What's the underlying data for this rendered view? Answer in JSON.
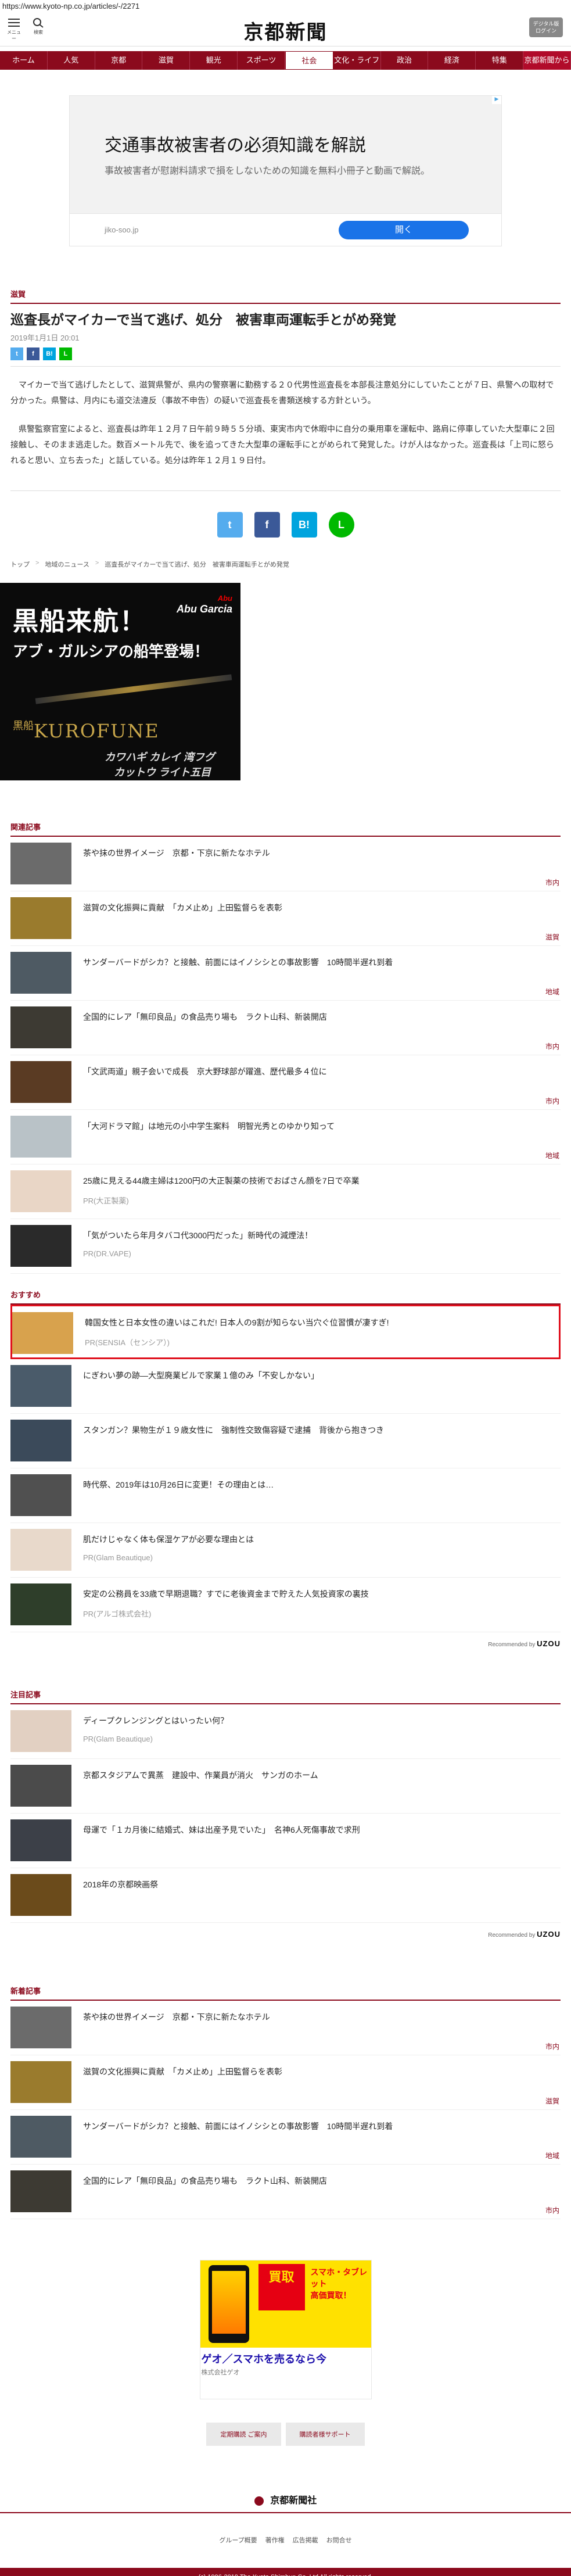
{
  "url": "https://www.kyoto-np.co.jp/articles/-/2271",
  "header": {
    "menu_label": "メニュー",
    "search_label": "検索",
    "logo": "京都新聞",
    "right_label_1": "デジタル版",
    "right_label_2": "ログイン"
  },
  "nav": [
    "ホーム",
    "人気",
    "京都",
    "滋賀",
    "観光",
    "スポーツ",
    "社会",
    "文化・ライフ",
    "政治",
    "経済",
    "特集",
    "京都新聞から"
  ],
  "colors": {
    "brand": "#8b0a1d",
    "ad_button": "#1a73e8",
    "highlight": "#e0101d"
  },
  "ad_top": {
    "title": "交通事故被害者の必須知識を解説",
    "desc": "事故被害者が慰謝料請求で損をしないための知識を無料小冊子と動画で解説。",
    "domain": "jiko-soo.jp",
    "button": "開く"
  },
  "article": {
    "category": "滋賀",
    "title": "巡査長がマイカーで当て逃げ、処分　被害車両運転手とがめ発覚",
    "date": "2019年1月1日 20:01",
    "paragraphs": [
      "マイカーで当て逃げしたとして、滋賀県警が、県内の警察署に勤務する２０代男性巡査長を本部長注意処分にしていたことが７日、県警への取材で分かった。県警は、月内にも道交法違反（事故不申告）の疑いで巡査長を書類送検する方針という。",
      "県警監察官室によると、巡査長は昨年１２月７日午前９時５５分頃、東実市内で休暇中に自分の乗用車を運転中、路肩に停車していた大型車に２回接触し、そのまま逃走した。数百メートル先で、後を追ってきた大型車の運転手にとがめられて発覚した。けが人はなかった。巡査長は「上司に怒られると思い、立ち去った」と話している。処分は昨年１２月１９日付。"
    ],
    "share_small": [
      "t",
      "f",
      "B!",
      "L"
    ],
    "share_big": [
      "t",
      "f",
      "B!",
      "L"
    ],
    "crumbs": [
      "トップ",
      "地域のニュース",
      "巡査長がマイカーで当て逃げ、処分　被害車両運転手とがめ発覚"
    ]
  },
  "ad_blackship": {
    "line1": "黒船来航！",
    "line2": "アブ・ガルシアの船竿登場！",
    "brand": "Abu Garcia",
    "brand_sub": "Abu",
    "product": "KUROFUNE",
    "kanji": "黒船",
    "sub1": "カワハギ カレイ 湾フグ",
    "sub2": "カットウ ライト五目"
  },
  "related": {
    "heading": "関連記事",
    "items": [
      {
        "title": "茶や抹の世界イメージ　京都・下京に新たなホテル",
        "tag": "市内",
        "pr": "",
        "img": "#6b6b6b"
      },
      {
        "title": "滋賀の文化振興に貢献　「カメ止め」上田監督らを表彰",
        "tag": "滋賀",
        "pr": "",
        "img": "#9a7b2d"
      },
      {
        "title": "サンダーバードがシカ？と接触、前面にはイノシシとの事故影響　10時間半遅れ到着",
        "tag": "地域",
        "pr": "",
        "img": "#4e5a63"
      },
      {
        "title": "全国的にレア「無印良品」の食品売り場も　ラクト山科、新装開店",
        "tag": "市内",
        "pr": "",
        "img": "#3d3a33"
      },
      {
        "title": "「文武両道」親子会いで成長　京大野球部が躍進、歴代最多４位に",
        "tag": "市内",
        "pr": "",
        "img": "#5a3b23"
      },
      {
        "title": "「大河ドラマ館」は地元の小中学生案料　明智光秀とのゆかり知って",
        "tag": "地域",
        "pr": "",
        "img": "#b9c2c7"
      },
      {
        "title": "25歳に見える44歳主婦は1200円の大正製薬の技術でおばさん顔を7日で卒業",
        "tag": "",
        "pr": "PR(大正製薬)",
        "img": "#e9d6c6"
      },
      {
        "title": "「気がついたら年月タバコ代3000円だった」新時代の減煙法！",
        "tag": "",
        "pr": "PR(DR.VAPE)",
        "img": "#2a2a2a"
      }
    ]
  },
  "recommended": {
    "heading": "おすすめ",
    "items": [
      {
        "title": "韓国女性と日本女性の違いはこれだ! 日本人の9割が知らない当穴ぐ位習慣が凄すぎ!",
        "pr": "PR(SENSIA（センシア）)",
        "img": "#d8a24d",
        "highlight": true
      },
      {
        "title": "にぎわい夢の跡―大型廃業ビルで家業１億のみ「不安しかない」",
        "pr": "",
        "img": "#4a5b6a",
        "highlight": false
      },
      {
        "title": "スタンガン？果物生が１９歳女性に　強制性交致傷容疑で逮捕　背後から抱きつき",
        "pr": "",
        "img": "#3b4a5a",
        "highlight": false
      },
      {
        "title": "時代祭、2019年は10月26日に変更！その理由とは…",
        "pr": "",
        "img": "#505050",
        "highlight": false
      },
      {
        "title": "肌だけじゃなく体も保湿ケアが必要な理由とは",
        "pr": "PR(Glam Beautique)",
        "img": "#e8d9cb",
        "highlight": false
      },
      {
        "title": "安定の公務員を33歳で早期退職？すでに老後資金まで貯えた人気投資家の裏技",
        "pr": "PR(アルゴ株式会社)",
        "img": "#2e3e2a",
        "highlight": false
      }
    ],
    "powered": "Recommended by",
    "powered_brand": "UZOU"
  },
  "attention": {
    "heading": "注目記事",
    "items": [
      {
        "title": "ディープクレンジングとはいったい何？",
        "pr": "PR(Glam Beautique)",
        "img": "#e2d0c2"
      },
      {
        "title": "京都スタジアムで異蒸　建設中、作業員が消火　サンガのホーム",
        "pr": "",
        "img": "#4b4b4b"
      },
      {
        "title": "母運で「１カ月後に結婚式、妹は出産予見でいた」　名神6人死傷事故で求刑",
        "pr": "",
        "img": "#3c4048"
      },
      {
        "title": "2018年の京都映画祭",
        "pr": "",
        "img": "#6b4b1b"
      }
    ],
    "powered": "Recommended by",
    "powered_brand": "UZOU"
  },
  "newest": {
    "heading": "新着記事",
    "items": [
      {
        "title": "茶や抹の世界イメージ　京都・下京に新たなホテル",
        "tag": "市内",
        "img": "#6b6b6b"
      },
      {
        "title": "滋賀の文化振興に貢献　「カメ止め」上田監督らを表彰",
        "tag": "滋賀",
        "img": "#9a7b2d"
      },
      {
        "title": "サンダーバードがシカ？と接触、前面にはイノシシとの事故影響　10時間半遅れ到着",
        "tag": "地域",
        "img": "#4e5a63"
      },
      {
        "title": "全国的にレア「無印良品」の食品売り場も　ラクト山科、新装開店",
        "tag": "市内",
        "img": "#3d3a33"
      }
    ]
  },
  "ad_bottom": {
    "kaitori": "買取",
    "right_1": "スマホ・タブレット",
    "right_2": "高価買取！",
    "title": "ゲオ／スマホを売るなら今",
    "advertiser": "株式会社ゲオ"
  },
  "footer": {
    "btn_1": "定期購読 ご案内",
    "btn_2": "購読者様サポート",
    "logo": "京都新聞社",
    "links": [
      "グループ概要",
      "著作権",
      "広告掲載",
      "お問合せ"
    ],
    "copyright": "(c) 1996-2019 The Kyoto Shimbun Co.,Ltd All rights reserved."
  }
}
